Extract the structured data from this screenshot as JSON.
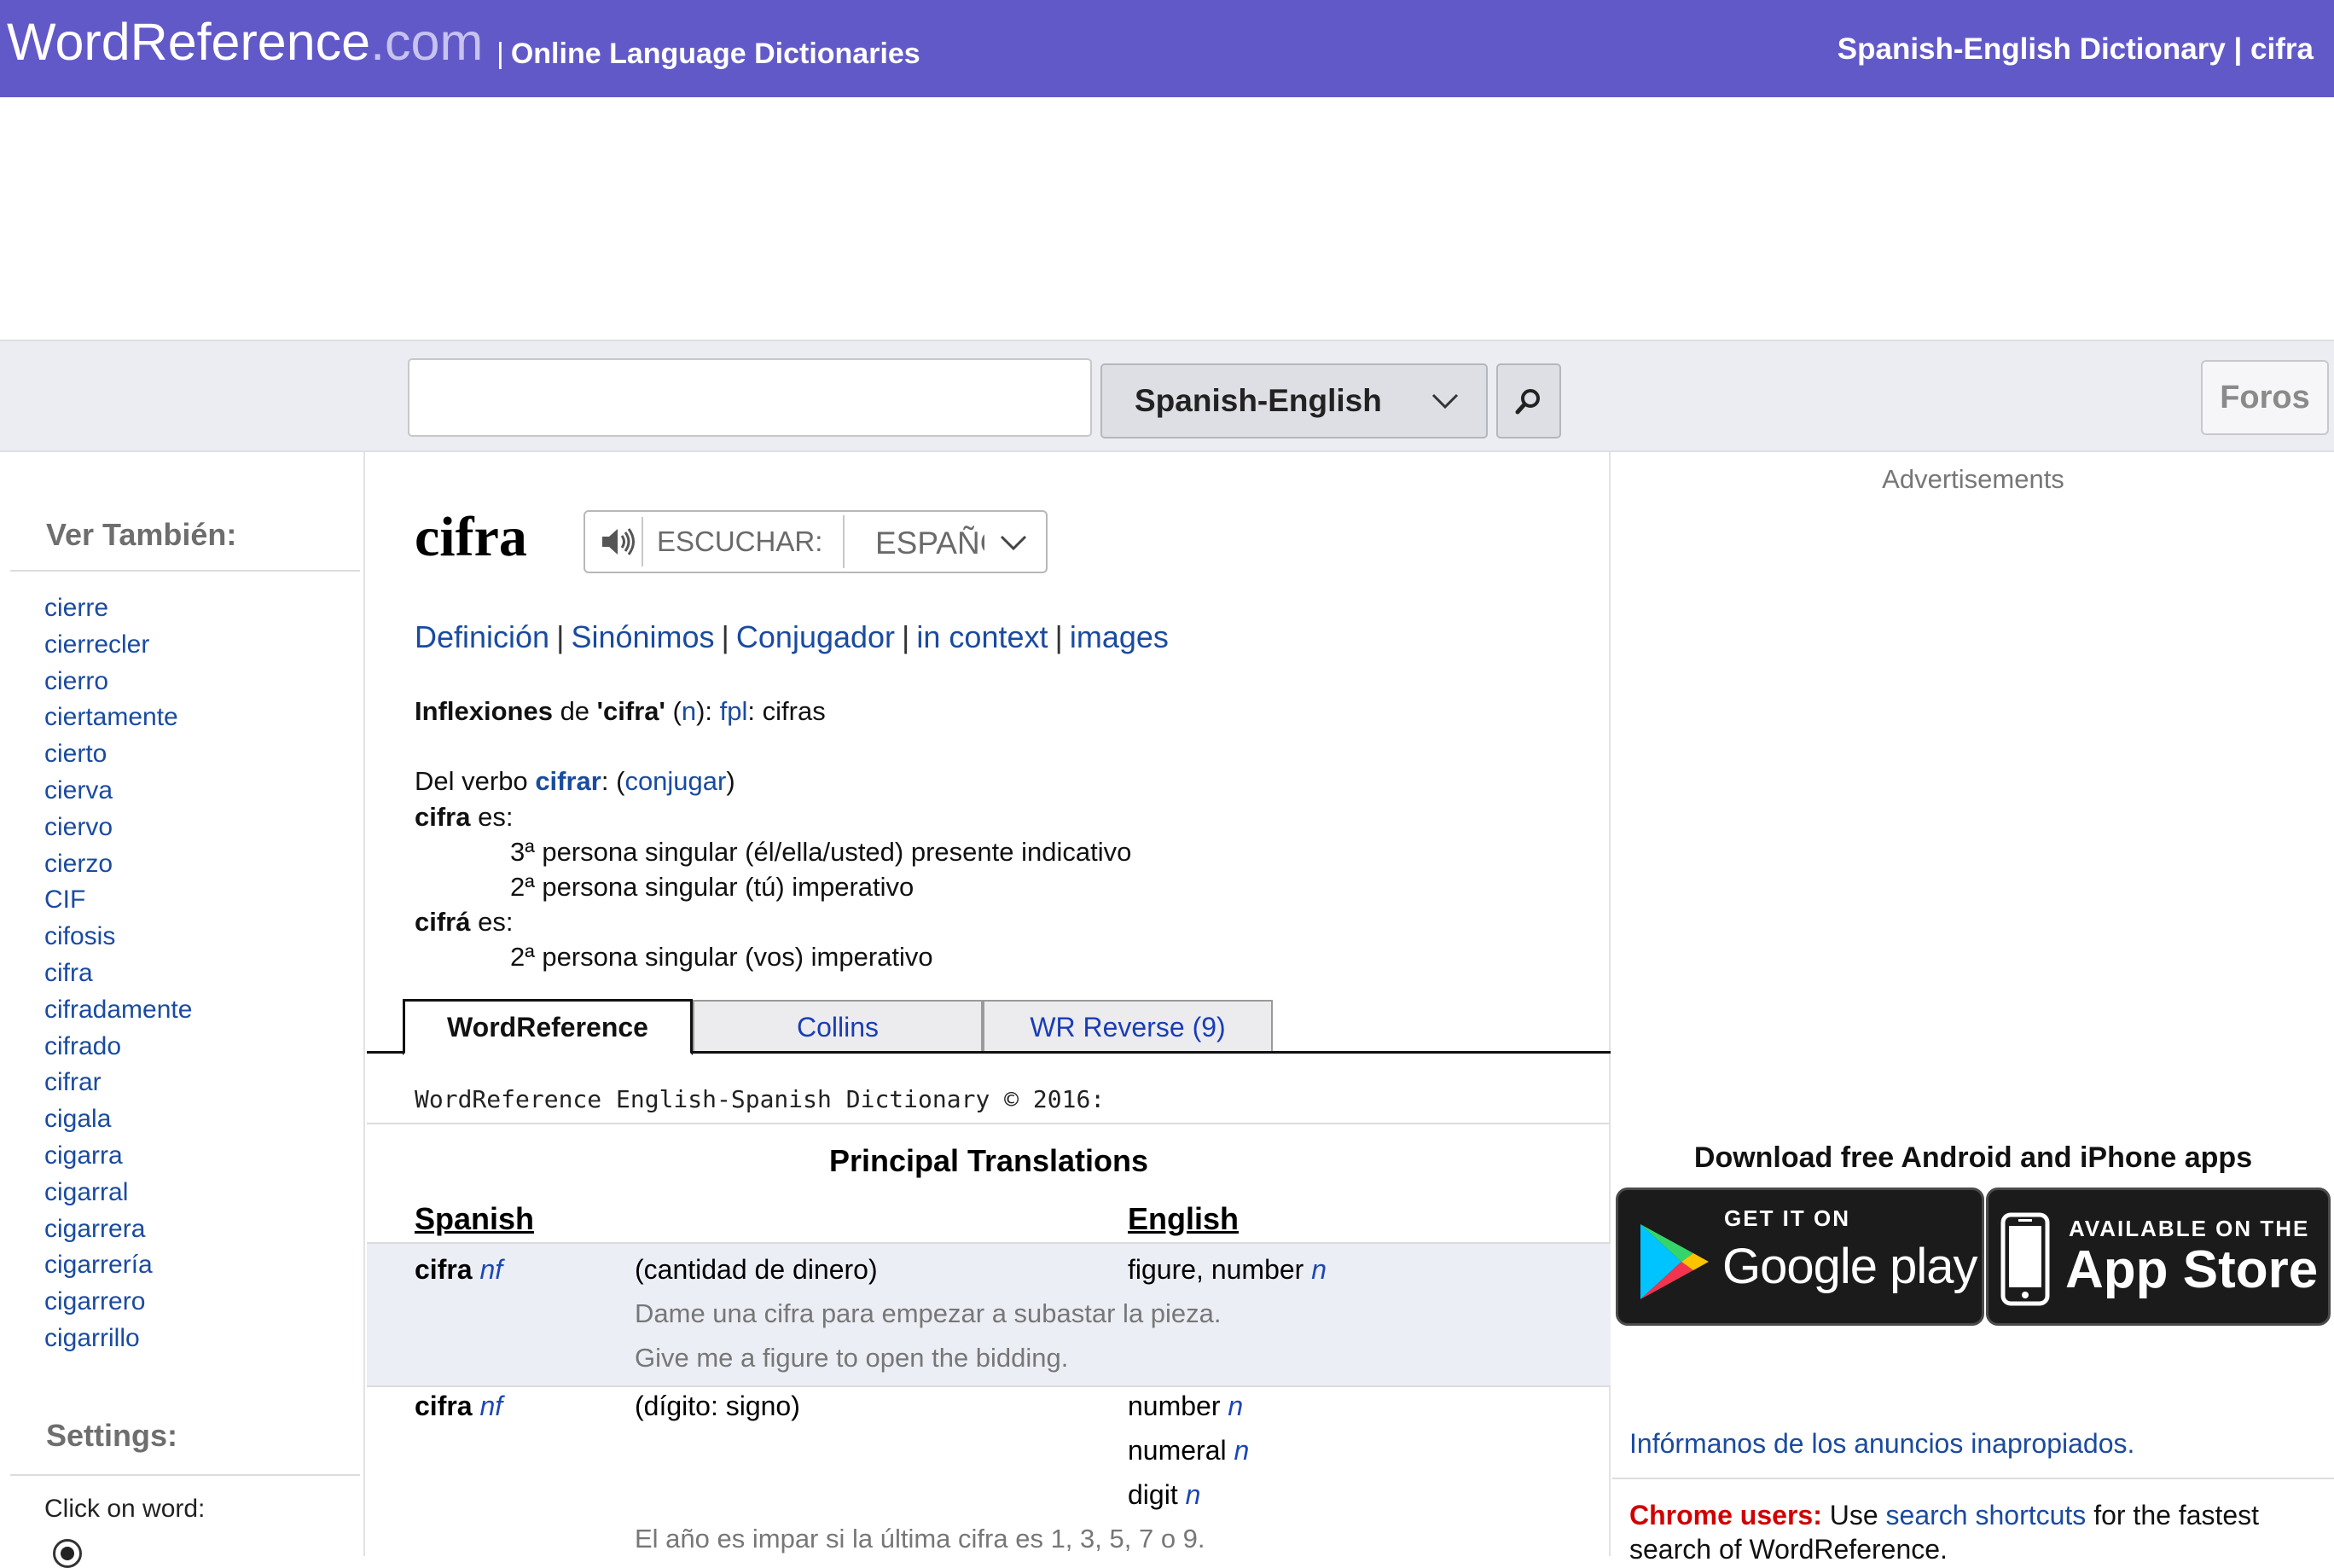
{
  "header": {
    "logo_main": "WordReference",
    "logo_dotcom": ".com",
    "tagline_pipe": "|",
    "tagline": "Online Language Dictionaries",
    "right_text": "Spanish-English Dictionary | cifra"
  },
  "search": {
    "value": "",
    "dictionary_selected": "Spanish-English",
    "foros_label": "Foros"
  },
  "sidebar": {
    "see_also_title": "Ver También:",
    "see_also": [
      "cierre",
      "cierrecler",
      "cierro",
      "ciertamente",
      "cierto",
      "cierva",
      "ciervo",
      "cierzo",
      "CIF",
      "cifosis",
      "cifra",
      "cifradamente",
      "cifrado",
      "cifrar",
      "cigala",
      "cigarra",
      "cigarral",
      "cigarrera",
      "cigarrería",
      "cigarrero",
      "cigarrillo"
    ],
    "settings_title": "Settings:",
    "click_on_word": "Click on word:"
  },
  "entry": {
    "headword": "cifra",
    "listen_label": "ESCUCHAR:",
    "listen_lang": "ESPAÑOL",
    "links": {
      "definicion": "Definición",
      "sinonimos": "Sinónimos",
      "conjugador": "Conjugador",
      "in_context": "in context",
      "images": "images",
      "sep": "|"
    },
    "inflections": {
      "label": "Inflexiones",
      "de": "de",
      "word_quoted": "'cifra'",
      "open_paren": "(",
      "pos": "n",
      "close_paren": "):",
      "form_label": "fpl",
      "form": ": cifras"
    },
    "verb": {
      "prefix": "Del verbo",
      "verb": "cifrar",
      "sep": ":",
      "open_paren": "(",
      "conjugar": "conjugar",
      "close_paren": ")",
      "form1": "cifra",
      "es1": "es:",
      "line1": "3ª persona singular (él/ella/usted) presente indicativo",
      "line2": "2ª persona singular (tú) imperativo",
      "form2": "cifrá",
      "es2": "es:",
      "line3": "2ª persona singular (vos) imperativo"
    },
    "tabs": [
      "WordReference",
      "Collins",
      "WR Reverse (9)"
    ],
    "copyright": "WordReference English-Spanish Dictionary © 2016:",
    "principal_title": "Principal Translations",
    "col_spanish": "Spanish",
    "col_english": "English",
    "rows": [
      {
        "term": "cifra",
        "pos": "nf",
        "sense": "(cantidad de dinero)",
        "translations": [
          {
            "text": "figure, number",
            "pos": "n"
          }
        ],
        "example_es": "Dame una cifra para empezar a subastar la pieza.",
        "example_en": "Give me a figure to open the bidding."
      },
      {
        "term": "cifra",
        "pos": "nf",
        "sense": "(dígito: signo)",
        "translations": [
          {
            "text": "number",
            "pos": "n"
          },
          {
            "text": "numeral",
            "pos": "n"
          },
          {
            "text": "digit",
            "pos": "n"
          }
        ],
        "example_es": "El año es impar si la última cifra es 1, 3, 5, 7 o 9."
      }
    ]
  },
  "right": {
    "ads_label": "Advertisements",
    "apps_title": "Download free Android and iPhone apps",
    "google_small": "GET IT ON",
    "google_big": "Google play",
    "apple_small": "AVAILABLE ON THE",
    "apple_big": "App Store",
    "report_link": "Infórmanos de los anuncios inapropiados.",
    "chrome_label": "Chrome users:",
    "chrome_use": "Use",
    "chrome_link": "search shortcuts",
    "chrome_rest": "for the fastest search of WordReference."
  },
  "colors": {
    "header_bg": "#6259c9",
    "link": "#1a4ba0",
    "pos": "#1b47b5",
    "row_highlight": "#eceef5",
    "chrome_red": "#d00000"
  }
}
